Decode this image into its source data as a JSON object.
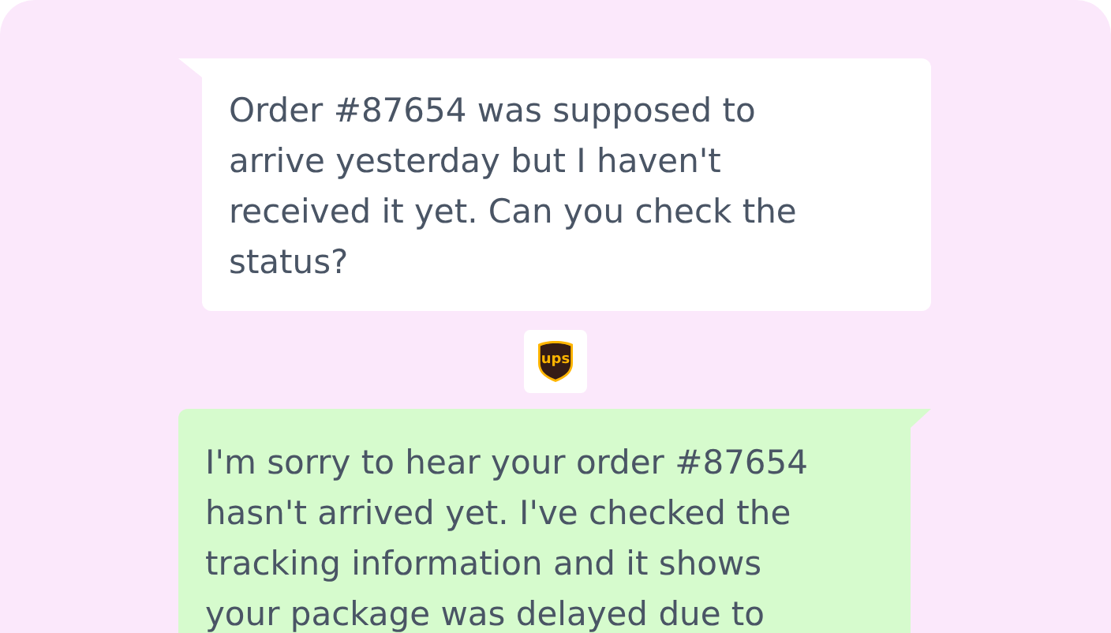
{
  "messages": [
    {
      "kind": "customer",
      "text": "Order #87654 was supposed to arrive yesterday but I haven't received it yet. Can you check the status?"
    },
    {
      "kind": "carrier",
      "logo_text": "ups"
    },
    {
      "kind": "agent",
      "text": "I'm sorry to hear your order #87654 hasn't arrived yet. I've checked the tracking information and it shows your package was delayed due to"
    }
  ]
}
